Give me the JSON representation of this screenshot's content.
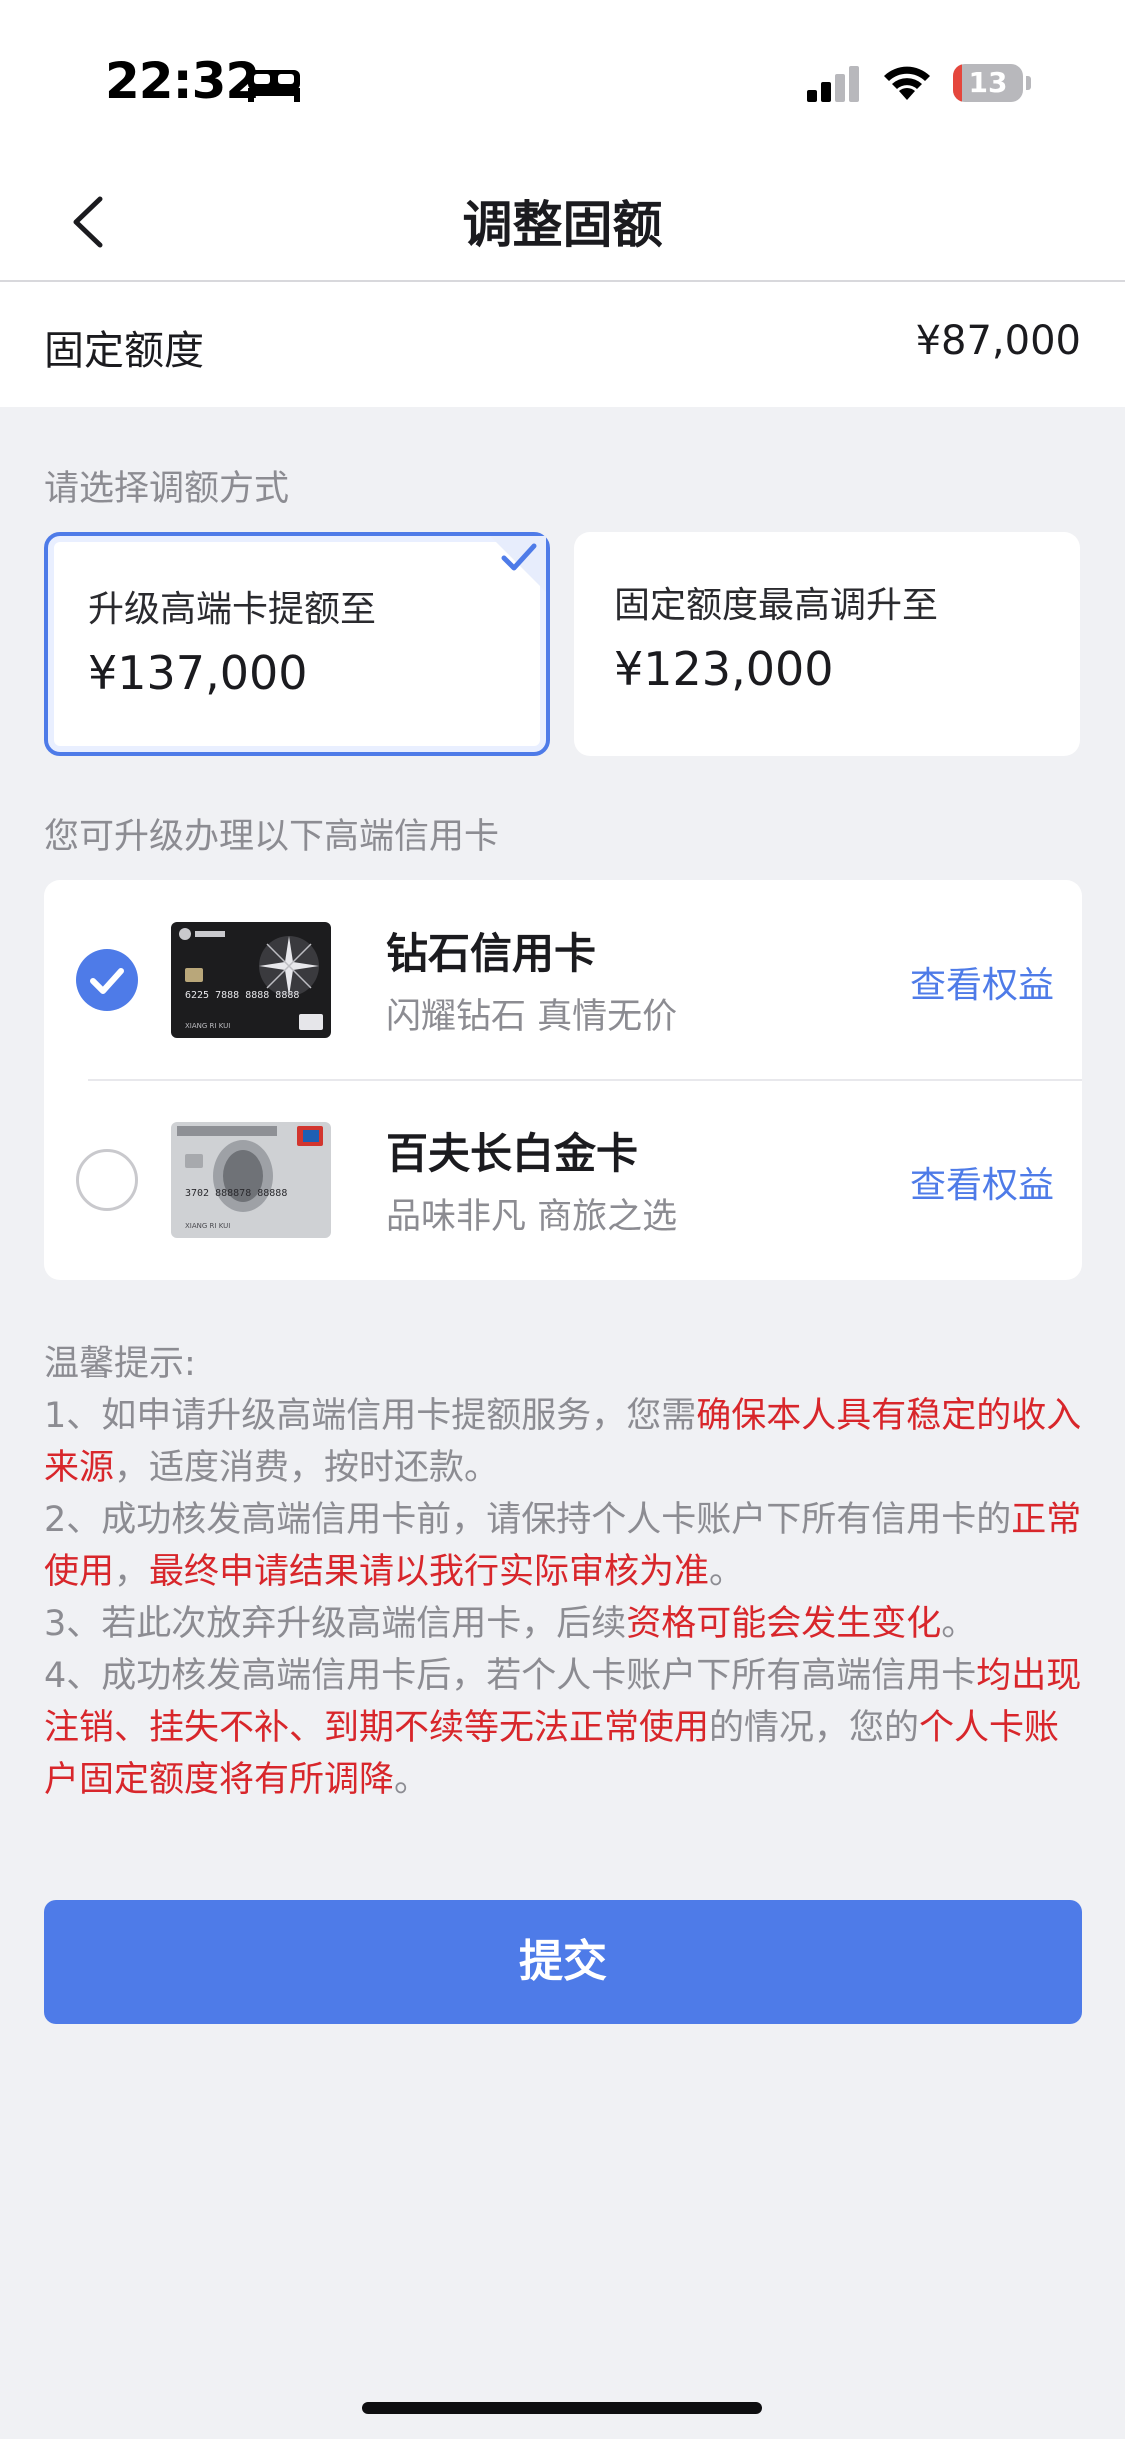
{
  "status_bar": {
    "time": "22:32",
    "battery_level": "13",
    "battery_fraction": 0.13
  },
  "nav": {
    "title": "调整固额"
  },
  "fixed_limit": {
    "label": "固定额度",
    "value": "¥87,000"
  },
  "adjust_section": {
    "label": "请选择调额方式",
    "options": [
      {
        "title": "升级高端卡提额至",
        "amount": "¥137,000",
        "selected": true
      },
      {
        "title": "固定额度最高调升至",
        "amount": "¥123,000",
        "selected": false
      }
    ]
  },
  "upgrade_section": {
    "label": "您可升级办理以下高端信用卡",
    "cards": [
      {
        "name": "钻石信用卡",
        "desc": "闪耀钻石 真情无价",
        "link": "查看权益",
        "selected": true,
        "thumb_number": "6225 7888 8888 8888",
        "thumb_holder": "XIANG RI KUI"
      },
      {
        "name": "百夫长白金卡",
        "desc": "品味非凡 商旅之选",
        "link": "查看权益",
        "selected": false,
        "thumb_number": "3702 888878 88888",
        "thumb_holder": "XIANG RI KUI"
      }
    ]
  },
  "tips": {
    "title": "温馨提示:",
    "items": [
      [
        {
          "text": "1、如申请升级高端信用卡提额服务，您需",
          "highlight": false
        },
        {
          "text": "确保本人具有稳定的收入来源",
          "highlight": true
        },
        {
          "text": "，适度消费，按时还款。",
          "highlight": false
        }
      ],
      [
        {
          "text": "2、成功核发高端信用卡前，请保持个人卡账户下所有信用卡的",
          "highlight": false
        },
        {
          "text": "正常使用",
          "highlight": true
        },
        {
          "text": "，",
          "highlight": false
        },
        {
          "text": "最终申请结果请以我行实际审核为准",
          "highlight": true
        },
        {
          "text": "。",
          "highlight": false
        }
      ],
      [
        {
          "text": "3、若此次放弃升级高端信用卡，后续",
          "highlight": false
        },
        {
          "text": "资格可能会发生变化",
          "highlight": true
        },
        {
          "text": "。",
          "highlight": false
        }
      ],
      [
        {
          "text": "4、成功核发高端信用卡后，若个人卡账户下所有高端信用卡",
          "highlight": false
        },
        {
          "text": "均出现注销、挂失不补、到期不续等无法正常使用",
          "highlight": true
        },
        {
          "text": "的情况，您的",
          "highlight": false
        },
        {
          "text": "个人卡账户固定额度将有所调降",
          "highlight": true
        },
        {
          "text": "。",
          "highlight": false
        }
      ]
    ]
  },
  "submit": {
    "label": "提交"
  },
  "colors": {
    "accent": "#4e7be8",
    "highlight": "#d8262b",
    "background": "#f0f1f4"
  }
}
